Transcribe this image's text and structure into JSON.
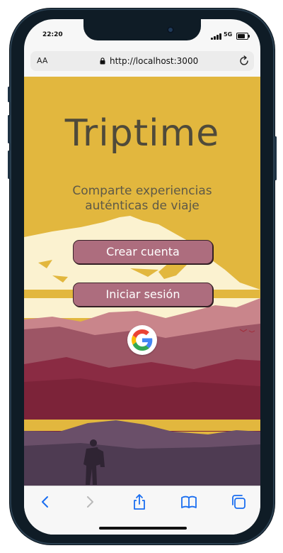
{
  "status_bar": {
    "time": "22:20",
    "network": "5G"
  },
  "browser": {
    "text_size_label": "AA",
    "url": "http://localhost:3000"
  },
  "app": {
    "title": "Triptime",
    "subtitle": "Comparte experiencias auténticas de viaje",
    "create_account_label": "Crear cuenta",
    "login_label": "Iniciar sesión"
  },
  "toolbar": {
    "items": [
      "back-icon",
      "forward-icon",
      "share-icon",
      "bookmarks-icon",
      "tabs-icon"
    ]
  },
  "colors": {
    "sky": "#e2b73e",
    "button": "#ad6d7e",
    "title": "#4f4a3a",
    "accent_blue": "#1a6ef0"
  }
}
